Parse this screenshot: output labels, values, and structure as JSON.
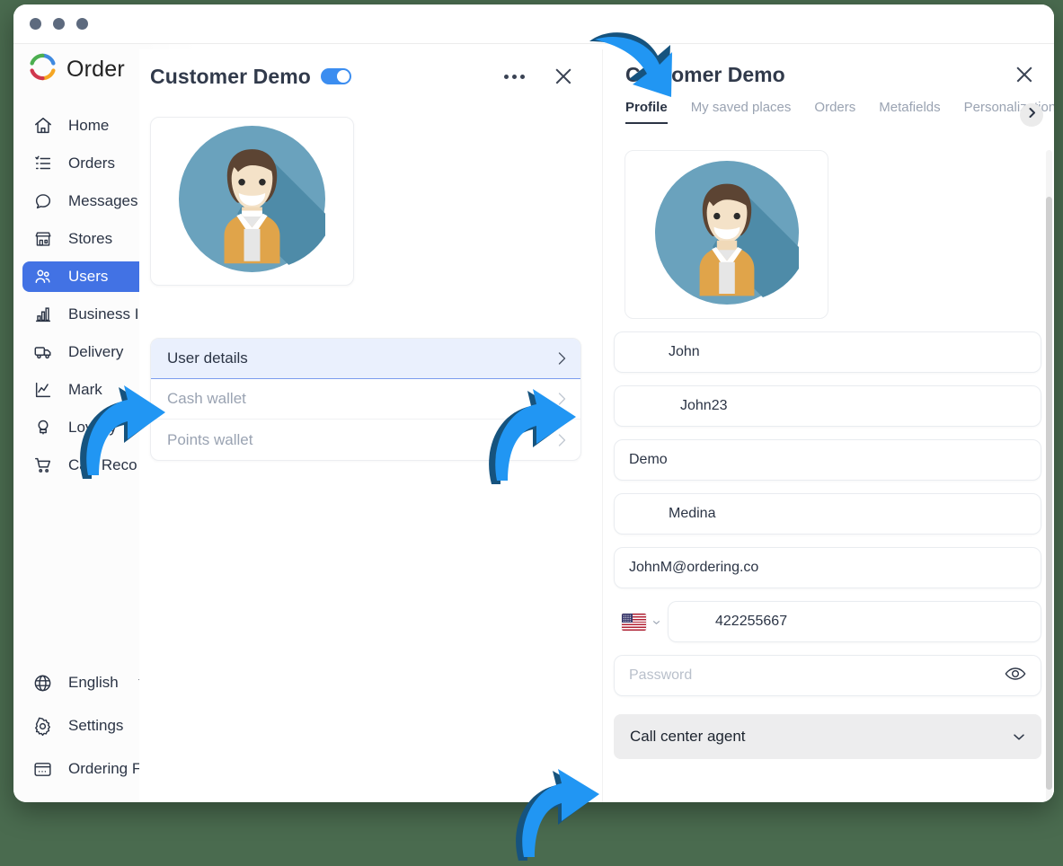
{
  "window": {
    "dots": 3
  },
  "brand": {
    "name": "Order",
    "logo_icon": "ordering-ring-logo"
  },
  "sidebar": {
    "items": [
      {
        "label": "Home",
        "icon": "home-icon",
        "active": false
      },
      {
        "label": "Orders",
        "icon": "list-icon",
        "active": false
      },
      {
        "label": "Messages",
        "icon": "chat-bubble-icon",
        "active": false
      },
      {
        "label": "Stores",
        "icon": "store-icon",
        "active": false
      },
      {
        "label": "Users",
        "icon": "users-icon",
        "active": true
      },
      {
        "label": "Business I",
        "icon": "bar-chart-icon",
        "active": false
      },
      {
        "label": "Delivery",
        "icon": "truck-icon",
        "active": false
      },
      {
        "label": "Mark",
        "icon": "line-chart-icon",
        "active": false
      },
      {
        "label": "Loyalty",
        "icon": "loyalty-badge-icon",
        "active": false
      },
      {
        "label": "Cart Reco",
        "icon": "shopping-cart-icon",
        "active": false
      }
    ],
    "bottom_items": [
      {
        "label": "English",
        "icon": "globe-icon",
        "has_caret": true
      },
      {
        "label": "Settings",
        "icon": "gear-icon",
        "has_caret": false
      },
      {
        "label": "Ordering F",
        "icon": "browser-window-icon",
        "has_caret": false
      }
    ],
    "active_color": "#4272e4"
  },
  "center_modal": {
    "title": "Customer Demo",
    "toggle_on": true,
    "toggle_color": "#3b8df0",
    "more_icon": "ellipsis-icon",
    "close_icon": "close-icon",
    "avatar_alt": "user-avatar",
    "list": [
      {
        "label": "User details",
        "selected": true
      },
      {
        "label": "Cash wallet",
        "selected": false
      },
      {
        "label": "Points wallet",
        "selected": false
      }
    ]
  },
  "right_panel": {
    "title": "Customer Demo",
    "close_icon": "close-icon",
    "tabs": [
      {
        "label": "Profile",
        "active": true
      },
      {
        "label": "My saved places",
        "active": false
      },
      {
        "label": "Orders",
        "active": false
      },
      {
        "label": "Metafields",
        "active": false
      },
      {
        "label": "Personalization",
        "active": false
      }
    ],
    "tab_next_icon": "chevron-right-icon",
    "avatar_alt": "user-avatar",
    "fields": {
      "first_name": "John",
      "nickname": "John23",
      "middle_name": "Demo",
      "last_name": "Medina",
      "email": "JohnM@ordering.co",
      "phone_country": "US",
      "phone": "422255667",
      "password_placeholder": "Password",
      "password_value": "",
      "eye_icon": "eye-icon",
      "role": "Call center agent",
      "role_caret_icon": "chevron-down-icon"
    }
  },
  "annotations": {
    "arrow_color": "#2196f3",
    "arrow_shadow_color": "#16537e",
    "arrows": [
      {
        "name": "arrow-to-profile-tab"
      },
      {
        "name": "arrow-to-user-details-left"
      },
      {
        "name": "arrow-to-user-details-right"
      },
      {
        "name": "arrow-to-bottom-panel"
      }
    ]
  }
}
